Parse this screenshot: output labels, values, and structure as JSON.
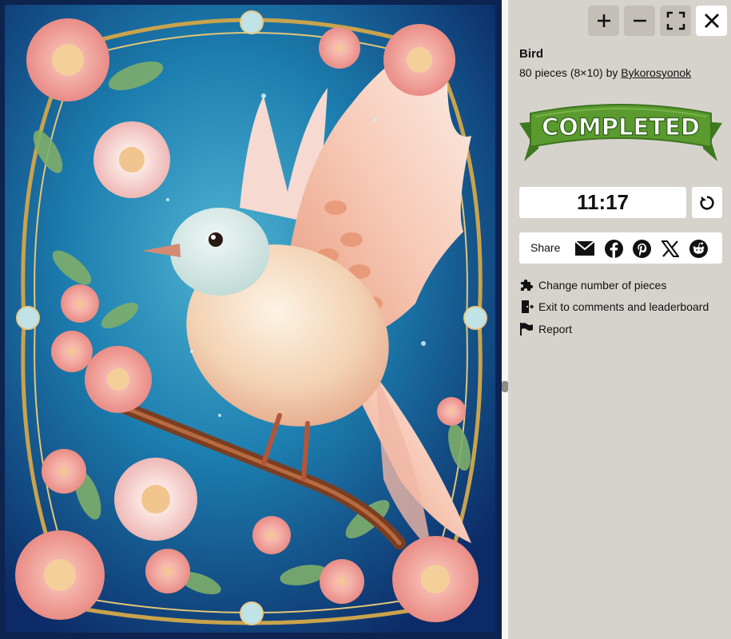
{
  "puzzle": {
    "image_alt": "bird"
  },
  "toolbar": {
    "zoom_in": "+",
    "zoom_out": "−"
  },
  "info": {
    "title": "Bird",
    "pieces_text": "80 pieces (8×10) by ",
    "author": "Bykorosyonok"
  },
  "status": {
    "ribbon_text": "COMPLETED",
    "ribbon_color": "#5a9a2e",
    "timer": "11:17"
  },
  "share": {
    "label": "Share",
    "targets": [
      "email-icon",
      "facebook-icon",
      "pinterest-icon",
      "x-icon",
      "reddit-icon"
    ]
  },
  "actions": [
    {
      "label": "Change number of pieces",
      "icon": "puzzle-piece-icon"
    },
    {
      "label": "Exit to comments and leaderboard",
      "icon": "exit-door-icon"
    },
    {
      "label": "Report",
      "icon": "flag-icon"
    }
  ],
  "colors": {
    "panel_bg": "#d6d3cd",
    "button_bg": "#c3bfb8",
    "puzzle_bg": "#0d2350"
  }
}
